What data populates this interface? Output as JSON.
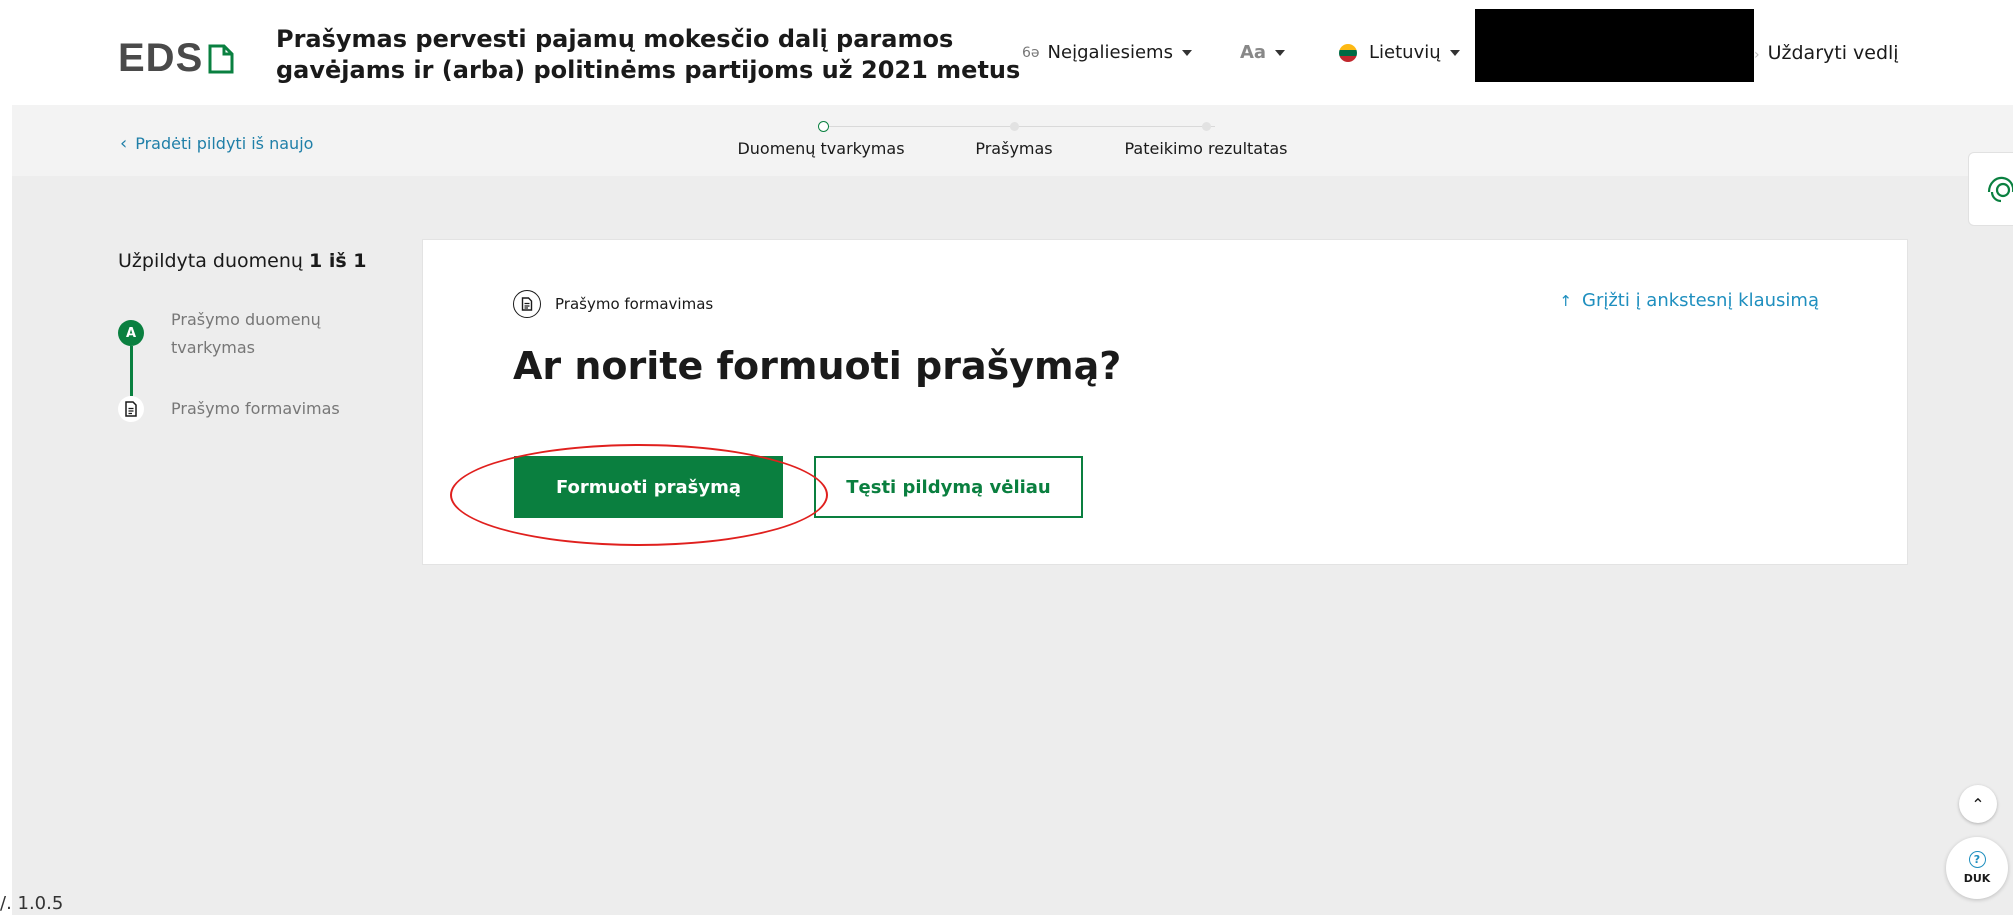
{
  "header": {
    "logo_text": "EDS",
    "title": "Prašymas pervesti pajamų mokesčio dalį paramos gavėjams ir (arba) politinėms partijoms už 2021 metus",
    "accessibility_label": "Neįgaliesiems",
    "font_size_label": "Aa",
    "language_label": "Lietuvių",
    "close_label": "Uždaryti vedlį"
  },
  "stepbar": {
    "back_label": "Pradėti pildyti iš naujo",
    "steps": [
      {
        "label": "Duomenų tvarkymas",
        "state": "active"
      },
      {
        "label": "Prašymas",
        "state": "idle"
      },
      {
        "label": "Pateikimo rezultatas",
        "state": "idle"
      }
    ]
  },
  "progress": {
    "title_prefix": "Užpildyta duomenų",
    "title_count": "1 iš 1",
    "items": [
      {
        "marker": "A",
        "label": "Prašymo duomenų tvarkymas"
      },
      {
        "marker": "document-icon",
        "label": "Prašymo formavimas"
      }
    ]
  },
  "card": {
    "section_label": "Prašymo formavimas",
    "back_question_label": "Grįžti į ankstesnį klausimą",
    "question": "Ar norite formuoti prašymą?",
    "primary_button": "Formuoti prašymą",
    "secondary_button": "Tęsti pildymą vėliau"
  },
  "floating": {
    "duk_label": "DUK"
  },
  "footer": {
    "version": "/. 1.0.5"
  },
  "colors": {
    "accent_green": "#0a7f3f",
    "link_blue": "#1f8fbf",
    "annotation_red": "#e0201e"
  }
}
